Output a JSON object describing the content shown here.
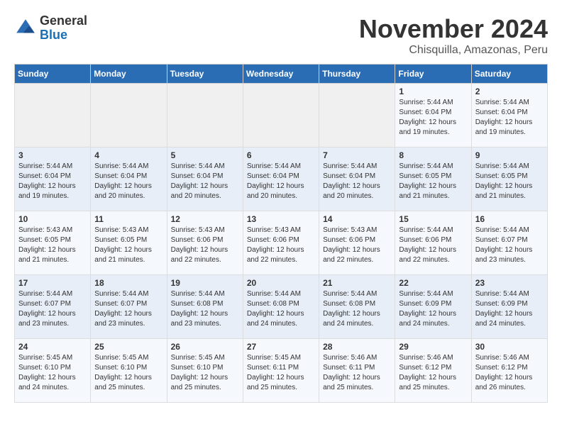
{
  "logo": {
    "general": "General",
    "blue": "Blue"
  },
  "title": "November 2024",
  "subtitle": "Chisquilla, Amazonas, Peru",
  "days_of_week": [
    "Sunday",
    "Monday",
    "Tuesday",
    "Wednesday",
    "Thursday",
    "Friday",
    "Saturday"
  ],
  "weeks": [
    [
      {
        "day": "",
        "sunrise": "",
        "sunset": "",
        "daylight": ""
      },
      {
        "day": "",
        "sunrise": "",
        "sunset": "",
        "daylight": ""
      },
      {
        "day": "",
        "sunrise": "",
        "sunset": "",
        "daylight": ""
      },
      {
        "day": "",
        "sunrise": "",
        "sunset": "",
        "daylight": ""
      },
      {
        "day": "",
        "sunrise": "",
        "sunset": "",
        "daylight": ""
      },
      {
        "day": "1",
        "sunrise": "Sunrise: 5:44 AM",
        "sunset": "Sunset: 6:04 PM",
        "daylight": "Daylight: 12 hours and 19 minutes."
      },
      {
        "day": "2",
        "sunrise": "Sunrise: 5:44 AM",
        "sunset": "Sunset: 6:04 PM",
        "daylight": "Daylight: 12 hours and 19 minutes."
      }
    ],
    [
      {
        "day": "3",
        "sunrise": "Sunrise: 5:44 AM",
        "sunset": "Sunset: 6:04 PM",
        "daylight": "Daylight: 12 hours and 19 minutes."
      },
      {
        "day": "4",
        "sunrise": "Sunrise: 5:44 AM",
        "sunset": "Sunset: 6:04 PM",
        "daylight": "Daylight: 12 hours and 20 minutes."
      },
      {
        "day": "5",
        "sunrise": "Sunrise: 5:44 AM",
        "sunset": "Sunset: 6:04 PM",
        "daylight": "Daylight: 12 hours and 20 minutes."
      },
      {
        "day": "6",
        "sunrise": "Sunrise: 5:44 AM",
        "sunset": "Sunset: 6:04 PM",
        "daylight": "Daylight: 12 hours and 20 minutes."
      },
      {
        "day": "7",
        "sunrise": "Sunrise: 5:44 AM",
        "sunset": "Sunset: 6:04 PM",
        "daylight": "Daylight: 12 hours and 20 minutes."
      },
      {
        "day": "8",
        "sunrise": "Sunrise: 5:44 AM",
        "sunset": "Sunset: 6:05 PM",
        "daylight": "Daylight: 12 hours and 21 minutes."
      },
      {
        "day": "9",
        "sunrise": "Sunrise: 5:44 AM",
        "sunset": "Sunset: 6:05 PM",
        "daylight": "Daylight: 12 hours and 21 minutes."
      }
    ],
    [
      {
        "day": "10",
        "sunrise": "Sunrise: 5:43 AM",
        "sunset": "Sunset: 6:05 PM",
        "daylight": "Daylight: 12 hours and 21 minutes."
      },
      {
        "day": "11",
        "sunrise": "Sunrise: 5:43 AM",
        "sunset": "Sunset: 6:05 PM",
        "daylight": "Daylight: 12 hours and 21 minutes."
      },
      {
        "day": "12",
        "sunrise": "Sunrise: 5:43 AM",
        "sunset": "Sunset: 6:06 PM",
        "daylight": "Daylight: 12 hours and 22 minutes."
      },
      {
        "day": "13",
        "sunrise": "Sunrise: 5:43 AM",
        "sunset": "Sunset: 6:06 PM",
        "daylight": "Daylight: 12 hours and 22 minutes."
      },
      {
        "day": "14",
        "sunrise": "Sunrise: 5:43 AM",
        "sunset": "Sunset: 6:06 PM",
        "daylight": "Daylight: 12 hours and 22 minutes."
      },
      {
        "day": "15",
        "sunrise": "Sunrise: 5:44 AM",
        "sunset": "Sunset: 6:06 PM",
        "daylight": "Daylight: 12 hours and 22 minutes."
      },
      {
        "day": "16",
        "sunrise": "Sunrise: 5:44 AM",
        "sunset": "Sunset: 6:07 PM",
        "daylight": "Daylight: 12 hours and 23 minutes."
      }
    ],
    [
      {
        "day": "17",
        "sunrise": "Sunrise: 5:44 AM",
        "sunset": "Sunset: 6:07 PM",
        "daylight": "Daylight: 12 hours and 23 minutes."
      },
      {
        "day": "18",
        "sunrise": "Sunrise: 5:44 AM",
        "sunset": "Sunset: 6:07 PM",
        "daylight": "Daylight: 12 hours and 23 minutes."
      },
      {
        "day": "19",
        "sunrise": "Sunrise: 5:44 AM",
        "sunset": "Sunset: 6:08 PM",
        "daylight": "Daylight: 12 hours and 23 minutes."
      },
      {
        "day": "20",
        "sunrise": "Sunrise: 5:44 AM",
        "sunset": "Sunset: 6:08 PM",
        "daylight": "Daylight: 12 hours and 24 minutes."
      },
      {
        "day": "21",
        "sunrise": "Sunrise: 5:44 AM",
        "sunset": "Sunset: 6:08 PM",
        "daylight": "Daylight: 12 hours and 24 minutes."
      },
      {
        "day": "22",
        "sunrise": "Sunrise: 5:44 AM",
        "sunset": "Sunset: 6:09 PM",
        "daylight": "Daylight: 12 hours and 24 minutes."
      },
      {
        "day": "23",
        "sunrise": "Sunrise: 5:44 AM",
        "sunset": "Sunset: 6:09 PM",
        "daylight": "Daylight: 12 hours and 24 minutes."
      }
    ],
    [
      {
        "day": "24",
        "sunrise": "Sunrise: 5:45 AM",
        "sunset": "Sunset: 6:10 PM",
        "daylight": "Daylight: 12 hours and 24 minutes."
      },
      {
        "day": "25",
        "sunrise": "Sunrise: 5:45 AM",
        "sunset": "Sunset: 6:10 PM",
        "daylight": "Daylight: 12 hours and 25 minutes."
      },
      {
        "day": "26",
        "sunrise": "Sunrise: 5:45 AM",
        "sunset": "Sunset: 6:10 PM",
        "daylight": "Daylight: 12 hours and 25 minutes."
      },
      {
        "day": "27",
        "sunrise": "Sunrise: 5:45 AM",
        "sunset": "Sunset: 6:11 PM",
        "daylight": "Daylight: 12 hours and 25 minutes."
      },
      {
        "day": "28",
        "sunrise": "Sunrise: 5:46 AM",
        "sunset": "Sunset: 6:11 PM",
        "daylight": "Daylight: 12 hours and 25 minutes."
      },
      {
        "day": "29",
        "sunrise": "Sunrise: 5:46 AM",
        "sunset": "Sunset: 6:12 PM",
        "daylight": "Daylight: 12 hours and 25 minutes."
      },
      {
        "day": "30",
        "sunrise": "Sunrise: 5:46 AM",
        "sunset": "Sunset: 6:12 PM",
        "daylight": "Daylight: 12 hours and 26 minutes."
      }
    ]
  ]
}
